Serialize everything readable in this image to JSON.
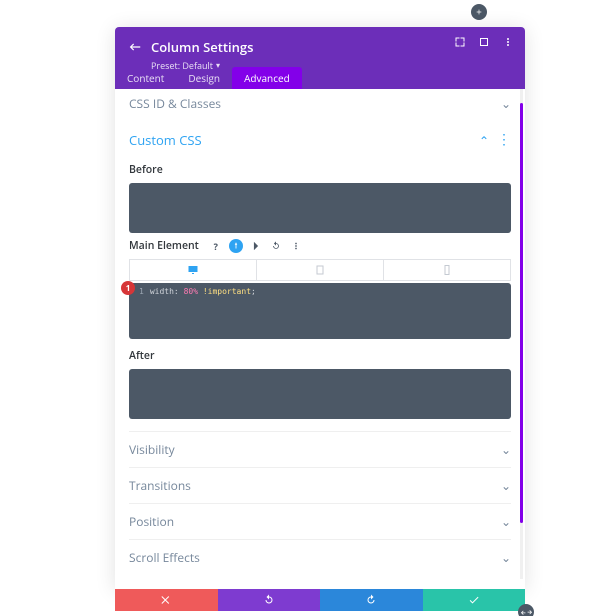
{
  "header": {
    "title": "Column Settings",
    "preset_label": "Preset: Default",
    "tabs": {
      "content": "Content",
      "design": "Design",
      "advanced": "Advanced",
      "active": "advanced"
    }
  },
  "sections": {
    "css_id_classes": "CSS ID & Classes",
    "custom_css": "Custom CSS",
    "visibility": "Visibility",
    "transitions": "Transitions",
    "position": "Position",
    "scroll_effects": "Scroll Effects"
  },
  "fields": {
    "before": "Before",
    "main_element": "Main Element",
    "after": "After"
  },
  "badge": "1",
  "code": {
    "line_no": "1",
    "prop": "width",
    "value": "80%",
    "important": "!important",
    "semi": ";"
  }
}
